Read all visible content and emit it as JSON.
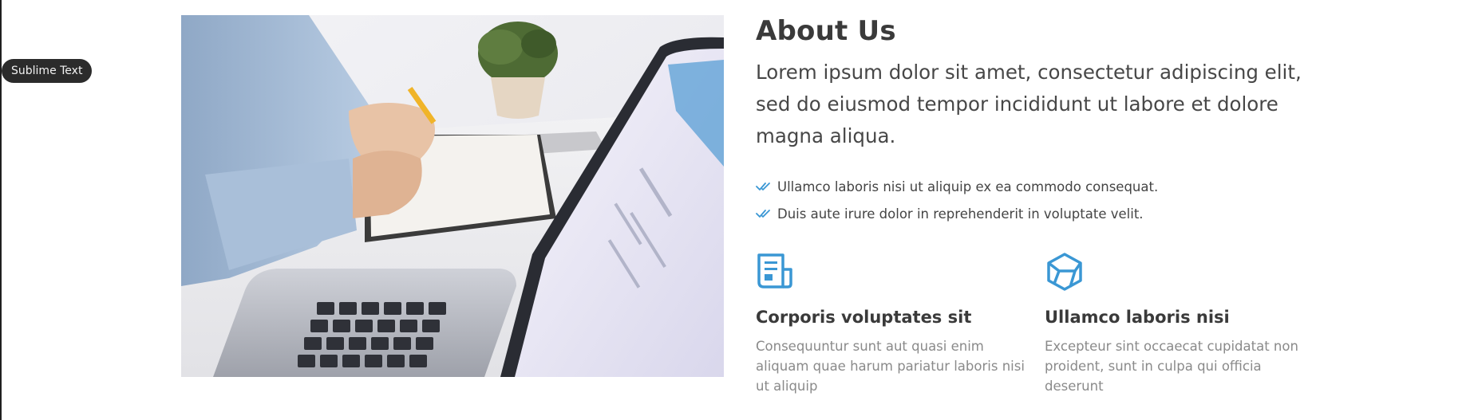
{
  "tooltip": {
    "label": "Sublime Text"
  },
  "about": {
    "title": "About Us",
    "lead": "Lorem ipsum dolor sit amet, consectetur adipiscing elit, sed do eiusmod tempor incididunt ut labore et dolore magna aliqua.",
    "checks": [
      "Ullamco laboris nisi ut aliquip ex ea commodo consequat.",
      "Duis aute irure dolor in reprehenderit in voluptate velit."
    ]
  },
  "features": [
    {
      "icon": "newspaper-icon",
      "title": "Corporis voluptates sit",
      "text": "Consequuntur sunt aut quasi enim aliquam quae harum pariatur laboris nisi ut aliquip"
    },
    {
      "icon": "cube-icon",
      "title": "Ullamco laboris nisi",
      "text": "Excepteur sint occaecat cupidatat non proident, sunt in culpa qui officia deserunt"
    }
  ],
  "colors": {
    "accent": "#3a97d4",
    "heading": "#3a3a3a",
    "body": "#474747",
    "muted": "#8a8a8a"
  }
}
